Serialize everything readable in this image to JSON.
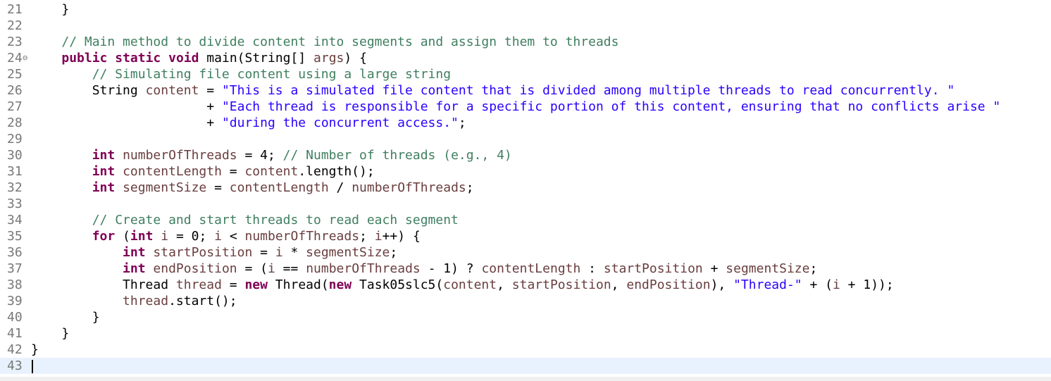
{
  "editor": {
    "lines": [
      {
        "n": "21",
        "segs": [
          {
            "t": "    }",
            "c": "p"
          }
        ]
      },
      {
        "n": "22",
        "segs": []
      },
      {
        "n": "23",
        "segs": [
          {
            "t": "    ",
            "c": "p"
          },
          {
            "t": "// Main method to divide content into segments and assign them to threads",
            "c": "cm"
          }
        ]
      },
      {
        "n": "24",
        "fold": "⊖",
        "segs": [
          {
            "t": "    ",
            "c": "p"
          },
          {
            "t": "public",
            "c": "kw"
          },
          {
            "t": " ",
            "c": "p"
          },
          {
            "t": "static",
            "c": "kw"
          },
          {
            "t": " ",
            "c": "p"
          },
          {
            "t": "void",
            "c": "kw"
          },
          {
            "t": " main(String[] ",
            "c": "p"
          },
          {
            "t": "args",
            "c": "ident"
          },
          {
            "t": ") {",
            "c": "p"
          }
        ]
      },
      {
        "n": "25",
        "segs": [
          {
            "t": "        ",
            "c": "p"
          },
          {
            "t": "// Simulating file content using a large string",
            "c": "cm"
          }
        ]
      },
      {
        "n": "26",
        "segs": [
          {
            "t": "        String ",
            "c": "p"
          },
          {
            "t": "content",
            "c": "ident"
          },
          {
            "t": " = ",
            "c": "p"
          },
          {
            "t": "\"This is a simulated file content that is divided among multiple threads to read concurrently. \"",
            "c": "st"
          }
        ]
      },
      {
        "n": "27",
        "segs": [
          {
            "t": "                       + ",
            "c": "p"
          },
          {
            "t": "\"Each thread is responsible for a specific portion of this content, ensuring that no conflicts arise \"",
            "c": "st"
          }
        ]
      },
      {
        "n": "28",
        "segs": [
          {
            "t": "                       + ",
            "c": "p"
          },
          {
            "t": "\"during the concurrent access.\"",
            "c": "st"
          },
          {
            "t": ";",
            "c": "p"
          }
        ]
      },
      {
        "n": "29",
        "segs": []
      },
      {
        "n": "30",
        "segs": [
          {
            "t": "        ",
            "c": "p"
          },
          {
            "t": "int",
            "c": "kw"
          },
          {
            "t": " ",
            "c": "p"
          },
          {
            "t": "numberOfThreads",
            "c": "ident"
          },
          {
            "t": " = 4; ",
            "c": "p"
          },
          {
            "t": "// Number of threads (e.g., 4)",
            "c": "cm"
          }
        ]
      },
      {
        "n": "31",
        "segs": [
          {
            "t": "        ",
            "c": "p"
          },
          {
            "t": "int",
            "c": "kw"
          },
          {
            "t": " ",
            "c": "p"
          },
          {
            "t": "contentLength",
            "c": "ident"
          },
          {
            "t": " = ",
            "c": "p"
          },
          {
            "t": "content",
            "c": "ident"
          },
          {
            "t": ".length();",
            "c": "p"
          }
        ]
      },
      {
        "n": "32",
        "segs": [
          {
            "t": "        ",
            "c": "p"
          },
          {
            "t": "int",
            "c": "kw"
          },
          {
            "t": " ",
            "c": "p"
          },
          {
            "t": "segmentSize",
            "c": "ident"
          },
          {
            "t": " = ",
            "c": "p"
          },
          {
            "t": "contentLength",
            "c": "ident"
          },
          {
            "t": " / ",
            "c": "p"
          },
          {
            "t": "numberOfThreads",
            "c": "ident"
          },
          {
            "t": ";",
            "c": "p"
          }
        ]
      },
      {
        "n": "33",
        "segs": []
      },
      {
        "n": "34",
        "segs": [
          {
            "t": "        ",
            "c": "p"
          },
          {
            "t": "// Create and start threads to read each segment",
            "c": "cm"
          }
        ]
      },
      {
        "n": "35",
        "segs": [
          {
            "t": "        ",
            "c": "p"
          },
          {
            "t": "for",
            "c": "kw"
          },
          {
            "t": " (",
            "c": "p"
          },
          {
            "t": "int",
            "c": "kw"
          },
          {
            "t": " ",
            "c": "p"
          },
          {
            "t": "i",
            "c": "ident"
          },
          {
            "t": " = 0; ",
            "c": "p"
          },
          {
            "t": "i",
            "c": "ident"
          },
          {
            "t": " < ",
            "c": "p"
          },
          {
            "t": "numberOfThreads",
            "c": "ident"
          },
          {
            "t": "; ",
            "c": "p"
          },
          {
            "t": "i",
            "c": "ident"
          },
          {
            "t": "++) {",
            "c": "p"
          }
        ]
      },
      {
        "n": "36",
        "segs": [
          {
            "t": "            ",
            "c": "p"
          },
          {
            "t": "int",
            "c": "kw"
          },
          {
            "t": " ",
            "c": "p"
          },
          {
            "t": "startPosition",
            "c": "ident"
          },
          {
            "t": " = ",
            "c": "p"
          },
          {
            "t": "i",
            "c": "ident"
          },
          {
            "t": " * ",
            "c": "p"
          },
          {
            "t": "segmentSize",
            "c": "ident"
          },
          {
            "t": ";",
            "c": "p"
          }
        ]
      },
      {
        "n": "37",
        "segs": [
          {
            "t": "            ",
            "c": "p"
          },
          {
            "t": "int",
            "c": "kw"
          },
          {
            "t": " ",
            "c": "p"
          },
          {
            "t": "endPosition",
            "c": "ident"
          },
          {
            "t": " = (",
            "c": "p"
          },
          {
            "t": "i",
            "c": "ident"
          },
          {
            "t": " == ",
            "c": "p"
          },
          {
            "t": "numberOfThreads",
            "c": "ident"
          },
          {
            "t": " - 1) ? ",
            "c": "p"
          },
          {
            "t": "contentLength",
            "c": "ident"
          },
          {
            "t": " : ",
            "c": "p"
          },
          {
            "t": "startPosition",
            "c": "ident"
          },
          {
            "t": " + ",
            "c": "p"
          },
          {
            "t": "segmentSize",
            "c": "ident"
          },
          {
            "t": ";",
            "c": "p"
          }
        ]
      },
      {
        "n": "38",
        "segs": [
          {
            "t": "            Thread ",
            "c": "p"
          },
          {
            "t": "thread",
            "c": "ident"
          },
          {
            "t": " = ",
            "c": "p"
          },
          {
            "t": "new",
            "c": "kw"
          },
          {
            "t": " Thread(",
            "c": "p"
          },
          {
            "t": "new",
            "c": "kw"
          },
          {
            "t": " Task05slc5(",
            "c": "p"
          },
          {
            "t": "content",
            "c": "ident"
          },
          {
            "t": ", ",
            "c": "p"
          },
          {
            "t": "startPosition",
            "c": "ident"
          },
          {
            "t": ", ",
            "c": "p"
          },
          {
            "t": "endPosition",
            "c": "ident"
          },
          {
            "t": "), ",
            "c": "p"
          },
          {
            "t": "\"Thread-\"",
            "c": "st"
          },
          {
            "t": " + (",
            "c": "p"
          },
          {
            "t": "i",
            "c": "ident"
          },
          {
            "t": " + 1));",
            "c": "p"
          }
        ]
      },
      {
        "n": "39",
        "segs": [
          {
            "t": "            ",
            "c": "p"
          },
          {
            "t": "thread",
            "c": "ident"
          },
          {
            "t": ".start();",
            "c": "p"
          }
        ]
      },
      {
        "n": "40",
        "segs": [
          {
            "t": "        }",
            "c": "p"
          }
        ]
      },
      {
        "n": "41",
        "segs": [
          {
            "t": "    }",
            "c": "p"
          }
        ]
      },
      {
        "n": "42",
        "segs": [
          {
            "t": "}",
            "c": "p"
          }
        ]
      },
      {
        "n": "43",
        "current": true,
        "segs": []
      }
    ]
  }
}
